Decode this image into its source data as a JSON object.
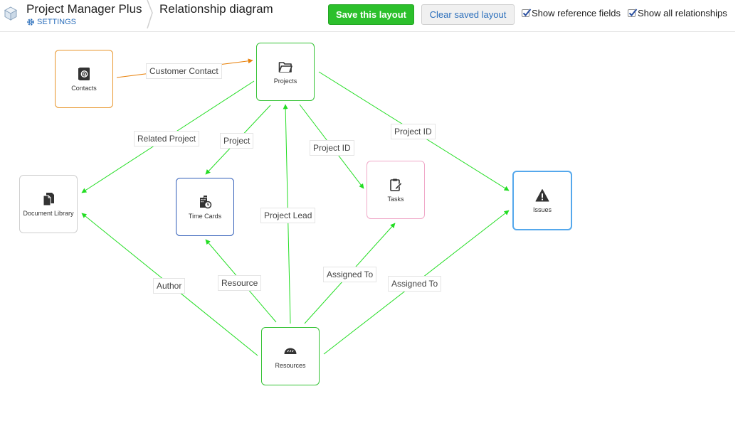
{
  "header": {
    "app_title": "Project Manager Plus",
    "settings_label": "SETTINGS",
    "page_title": "Relationship diagram",
    "save_label": "Save this layout",
    "clear_label": "Clear saved layout",
    "show_reference_fields": {
      "label": "Show reference fields",
      "checked": true
    },
    "show_all_relationships": {
      "label": "Show all relationships",
      "checked": true
    }
  },
  "colors": {
    "edge_green": "#22dd22",
    "edge_orange": "#e8820c",
    "save_button": "#2cc02c",
    "link_blue": "#2a6ebb"
  },
  "nodes": {
    "contacts": {
      "label": "Contacts",
      "icon": "contact-book-icon",
      "border": "#e8952a"
    },
    "projects": {
      "label": "Projects",
      "icon": "folder-open-icon",
      "border": "#34c234"
    },
    "document_library": {
      "label": "Document Library",
      "icon": "documents-icon",
      "border": "#cfcfcf"
    },
    "time_cards": {
      "label": "Time Cards",
      "icon": "timecard-building-icon",
      "border": "#2f5db8"
    },
    "tasks": {
      "label": "Tasks",
      "icon": "clipboard-edit-icon",
      "border": "#f0a8c8"
    },
    "issues": {
      "label": "Issues",
      "icon": "warning-icon",
      "border": "#55a8ec"
    },
    "resources": {
      "label": "Resources",
      "icon": "bread-icon",
      "border": "#34c234"
    }
  },
  "edge_labels": {
    "customer_contact": "Customer Contact",
    "related_project": "Related Project",
    "project_timecards": "Project",
    "project_id_tasks": "Project ID",
    "project_id_issues": "Project ID",
    "project_lead": "Project Lead",
    "author": "Author",
    "resource": "Resource",
    "assigned_to_tasks": "Assigned To",
    "assigned_to_issues": "Assigned To"
  }
}
